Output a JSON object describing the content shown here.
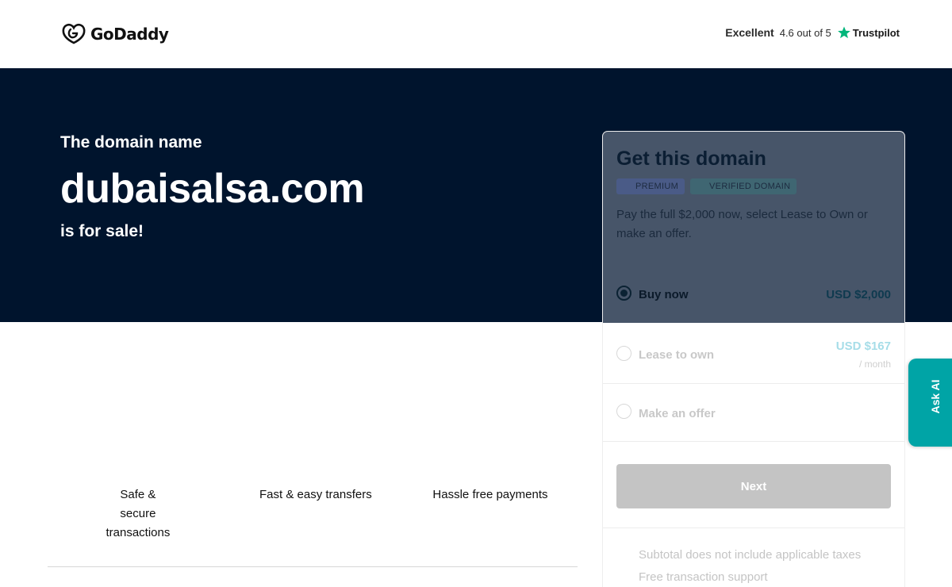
{
  "header": {
    "brand": "GoDaddy",
    "rating_label": "Excellent",
    "rating_score": "4.6 out of 5",
    "review_site": "Trustpilot",
    "star_color": "#00b67a"
  },
  "hero": {
    "lead": "The domain name",
    "domain": "dubaisalsa.com",
    "tail": "is for sale!",
    "background": "#00142d"
  },
  "features": [
    {
      "label": "Safe & secure transactions"
    },
    {
      "label": "Fast & easy transfers"
    },
    {
      "label": "Hassle free payments"
    }
  ],
  "purchase_card": {
    "title": "Get this domain",
    "badges": [
      "PREMIUM",
      "VERIFIED DOMAIN"
    ],
    "description": "Pay the full $2,000 now, select Lease to Own or make an offer.",
    "options": [
      {
        "label": "Buy now",
        "price": "USD $2,000",
        "selected": true
      },
      {
        "label": "Lease to own",
        "price": "USD $167",
        "period": "/ month",
        "selected": false
      },
      {
        "label": "Make an offer",
        "selected": false
      }
    ],
    "next_label": "Next",
    "notes": [
      "Subtotal does not include applicable taxes",
      "Free transaction support"
    ]
  },
  "ask_ai": {
    "label": "Ask AI",
    "color": "#00a4a6"
  }
}
